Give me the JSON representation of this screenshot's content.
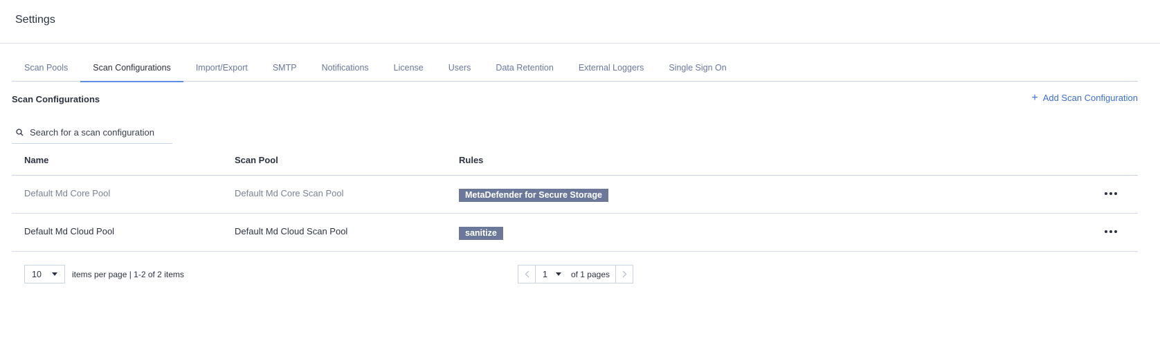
{
  "header": {
    "title": "Settings"
  },
  "tabs": [
    {
      "label": "Scan Pools",
      "active": false
    },
    {
      "label": "Scan Configurations",
      "active": true
    },
    {
      "label": "Import/Export",
      "active": false
    },
    {
      "label": "SMTP",
      "active": false
    },
    {
      "label": "Notifications",
      "active": false
    },
    {
      "label": "License",
      "active": false
    },
    {
      "label": "Users",
      "active": false
    },
    {
      "label": "Data Retention",
      "active": false
    },
    {
      "label": "External Loggers",
      "active": false
    },
    {
      "label": "Single Sign On",
      "active": false
    }
  ],
  "section": {
    "title": "Scan Configurations",
    "add_label": "Add Scan Configuration"
  },
  "search": {
    "placeholder": "Search for a scan configuration",
    "value": ""
  },
  "table": {
    "columns": [
      "Name",
      "Scan Pool",
      "Rules"
    ],
    "rows": [
      {
        "name": "Default Md Core Pool",
        "scan_pool": "Default Md Core Scan Pool",
        "rule": "MetaDefender for Secure Storage"
      },
      {
        "name": "Default Md Cloud Pool",
        "scan_pool": "Default Md Cloud Scan Pool",
        "rule": "sanitize"
      }
    ]
  },
  "pagination": {
    "per_page": "10",
    "summary": "items per page | 1-2 of 2 items",
    "current_page": "1",
    "total_label": "of 1 pages"
  },
  "colors": {
    "accent": "#3b6fd6",
    "tab_active_underline": "#5b8de0",
    "badge_bg": "#6b7899",
    "tab_text": "#6a78a0"
  },
  "icons": {
    "search": "search-icon",
    "add": "plus-icon",
    "row_menu": "more-horizontal-icon",
    "dropdown": "caret-down-icon",
    "prev": "chevron-left-icon",
    "next": "chevron-right-icon"
  }
}
